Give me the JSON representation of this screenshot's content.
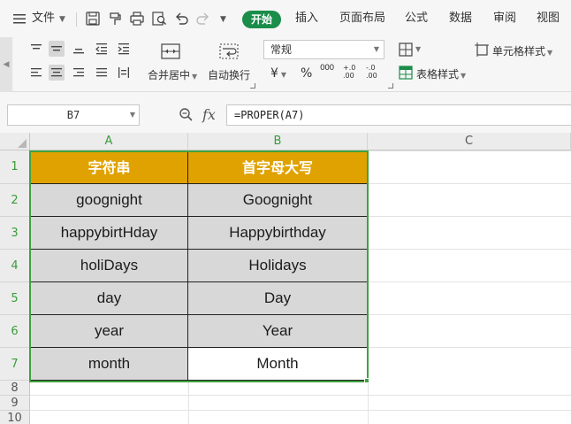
{
  "menubar": {
    "file_label": "文件",
    "tabs": [
      "开始",
      "插入",
      "页面布局",
      "公式",
      "数据",
      "审阅",
      "视图"
    ],
    "active_tab": "开始"
  },
  "ribbon": {
    "merge_label": "合并居中",
    "wrap_label": "自动换行",
    "number_format": "常规",
    "currency_symbol": "¥",
    "percent_symbol": "%",
    "thousands_symbol": "000",
    "dec_increase": "+.0 .00",
    "dec_decrease": "-.0 .00",
    "cell_style_label": "单元格样式",
    "table_style_label": "表格样式"
  },
  "formula_bar": {
    "cell_ref": "B7",
    "fx_label": "fx",
    "formula": "=PROPER(A7)"
  },
  "sheet": {
    "columns": [
      "A",
      "B",
      "C"
    ],
    "rows": [
      "1",
      "2",
      "3",
      "4",
      "5",
      "6",
      "7",
      "8",
      "9",
      "10"
    ],
    "header": [
      "字符串",
      "首字母大写"
    ],
    "data": [
      [
        "goognight",
        "Goognight"
      ],
      [
        "happybirtHday",
        "Happybirthday"
      ],
      [
        "holiDays",
        "Holidays"
      ],
      [
        "day",
        "Day"
      ],
      [
        "year",
        "Year"
      ],
      [
        "month",
        "Month"
      ]
    ]
  },
  "colors": {
    "accent": "#1a8d4a",
    "header_fill": "#e0a200",
    "cell_fill": "#d8d8d8",
    "selection": "#3fa23f"
  }
}
